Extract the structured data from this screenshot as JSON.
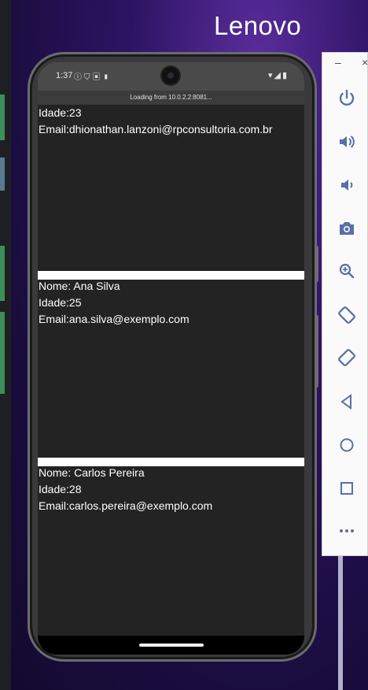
{
  "background": {
    "brand_text": "Lenovo",
    "accent_color": "#2d1463"
  },
  "status_bar": {
    "time": "1:37",
    "left_icons": [
      "info-icon",
      "shield-icon",
      "sim-icon",
      "sdcard-icon"
    ],
    "right_icons": [
      "wifi-icon",
      "signal-icon",
      "battery-icon"
    ]
  },
  "loading_banner": "Loading from 10.0.2.2:8081...",
  "users": [
    {
      "nome": "",
      "idade": "Idade:23",
      "email": "Email:dhionathan.lanzoni@rpconsultoria.com.br"
    },
    {
      "nome": "Nome: Ana Silva",
      "idade": "Idade:25",
      "email": "Email:ana.silva@exemplo.com"
    },
    {
      "nome": "Nome: Carlos Pereira",
      "idade": "Idade:28",
      "email": "Email:carlos.pereira@exemplo.com"
    }
  ],
  "emulator_toolbar": {
    "minimize": "–",
    "close": "×",
    "buttons": [
      "power-icon",
      "volume-up-icon",
      "volume-down-icon",
      "camera-icon",
      "zoom-icon",
      "rotate-left-icon",
      "rotate-right-icon",
      "back-icon",
      "home-icon",
      "overview-icon",
      "more-icon"
    ]
  }
}
